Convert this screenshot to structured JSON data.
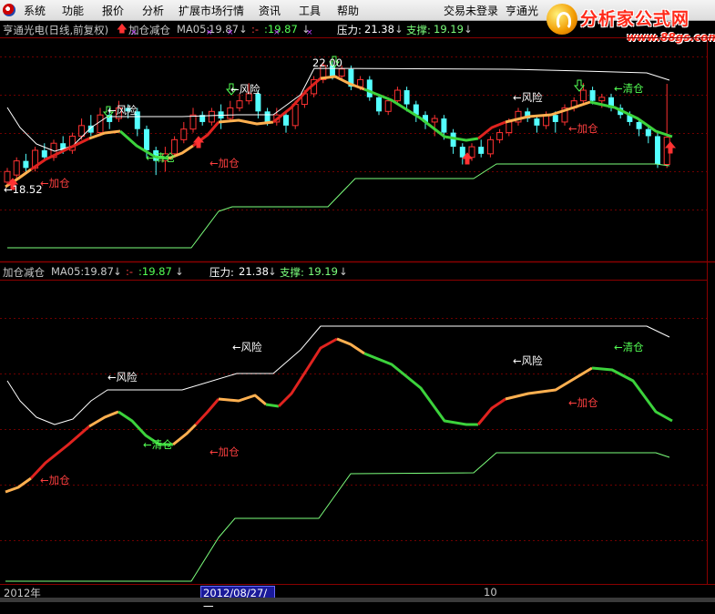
{
  "menu": [
    "系统",
    "功能",
    "报价",
    "分析",
    "扩展市场行情",
    "资讯",
    "工具",
    "帮助"
  ],
  "login_status": "交易未登录",
  "stock_short": "亨通光",
  "brand": {
    "title": "分析家公式网",
    "url": "www.88gs.com"
  },
  "main_title": {
    "stock": "亨通光电(日线,前复权)",
    "indicator": "加仓减仓",
    "ma_label": "MA05:",
    "ma_value": "19.87",
    "dash_label": ":-",
    "dash_value": ":19.87",
    "pressure_label": "压力:",
    "pressure_value": "21.38",
    "support_label": "支撑:",
    "support_value": "19.19"
  },
  "sub_title": {
    "indicator": "加仓减仓",
    "ma_label": "MA05:",
    "ma_value": "19.87",
    "dash_label": ":-",
    "dash_value": ":19.87",
    "pressure_label": "压力:",
    "pressure_value": "21.38",
    "support_label": "支撑:",
    "support_value": "19.19"
  },
  "main_annotations": {
    "high_label": "22.00",
    "low_label": "←18.52",
    "risk": "←风险",
    "clear": "←清仓",
    "add": "←加仓"
  },
  "sub_annotations": {
    "risk": "←风险",
    "clear": "←清仓",
    "add": "←加仓"
  },
  "timebar": {
    "year": "2012年",
    "cursor_date": "2012/08/27/一",
    "month": "10"
  },
  "colors": {
    "up": "#ff3232",
    "down": "#54ffff",
    "red_line": "#e0231f",
    "orange_line": "#ffb050",
    "green_line": "#3cd23c",
    "pressure_line": "#ffffff",
    "support_line": "#7cff7c",
    "label_green": "#54ff54",
    "label_red": "#ff4040",
    "label_yellow": "#ffff54",
    "divider": "#8a0000"
  }
}
